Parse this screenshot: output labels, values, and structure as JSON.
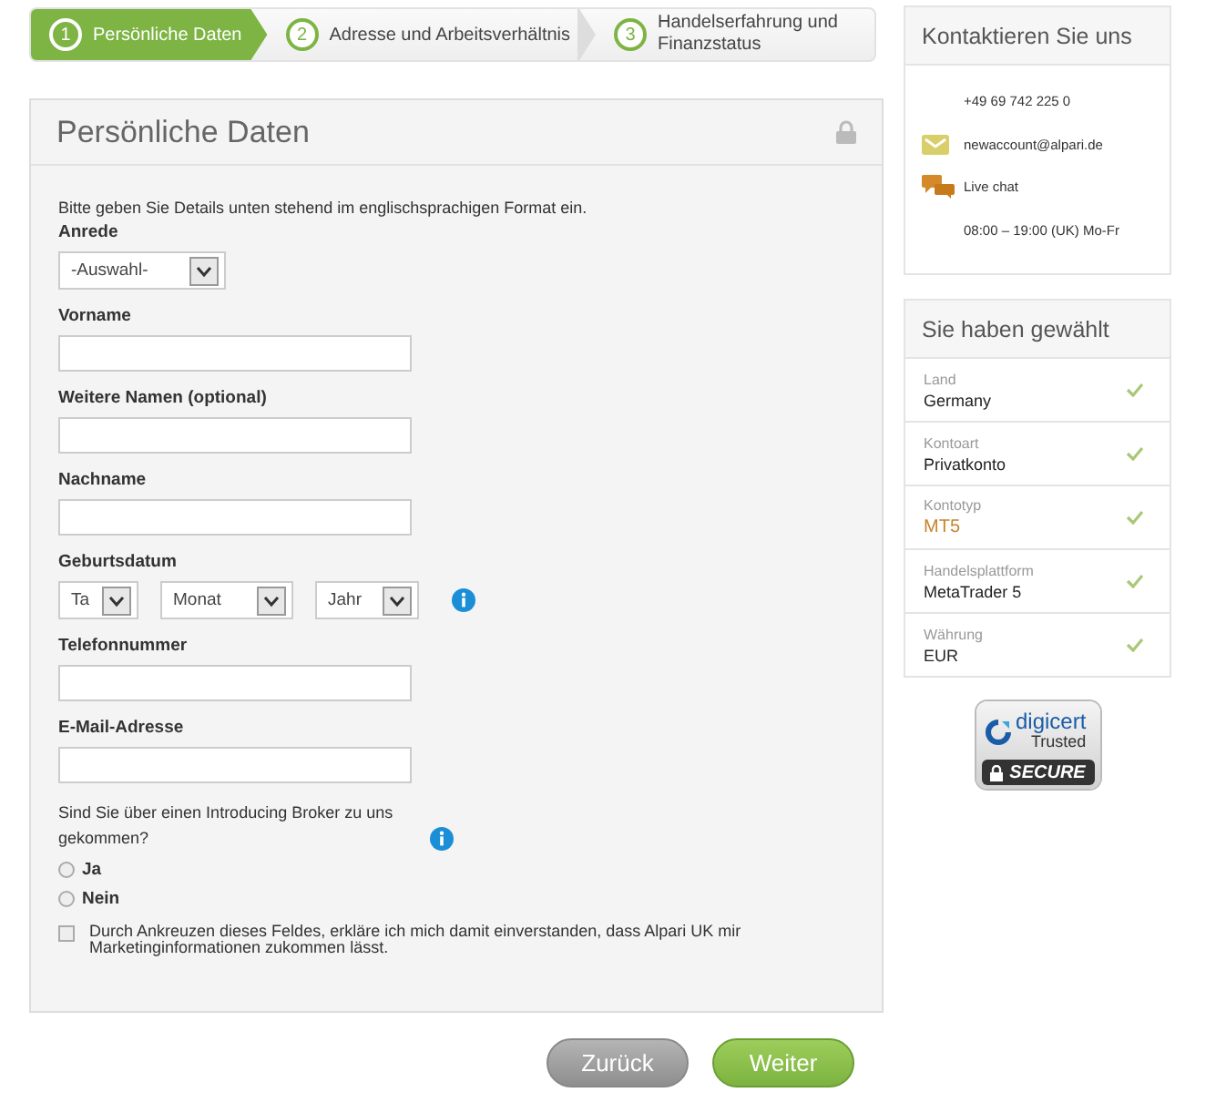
{
  "steps": [
    {
      "number": "1",
      "label": "Persönliche Daten",
      "selected": true
    },
    {
      "number": "2",
      "label": "Adresse und Arbeitsverhältnis",
      "selected": false
    },
    {
      "number": "3",
      "label": "Handelserfahrung und Finanzstatus",
      "selected": false
    }
  ],
  "form": {
    "title": "Persönliche Daten",
    "intro": "Bitte geben Sie Details unten stehend im englischsprachigen Format ein.",
    "fields": [
      {
        "kind": "select",
        "label": "Anrede",
        "value": "-Auswahl-"
      },
      {
        "kind": "text",
        "label": "Vorname"
      },
      {
        "kind": "text",
        "label": "Weitere Namen (optional)"
      },
      {
        "kind": "text",
        "label": "Nachname"
      },
      {
        "kind": "date",
        "label": "Geburtsdatum",
        "parts": [
          "Ta",
          "Monat",
          "Jahr"
        ],
        "info": true
      },
      {
        "kind": "text",
        "label": "Telefonnummer"
      },
      {
        "kind": "text",
        "label": "E-Mail-Adresse"
      },
      {
        "kind": "radio",
        "label": "Sind Sie über einen Introducing Broker zu uns gekommen?",
        "info": true,
        "options": [
          {
            "label": "Ja",
            "selected": false
          },
          {
            "label": "Nein",
            "selected": false
          }
        ]
      },
      {
        "kind": "checkbox",
        "label": "Durch Ankreuzen dieses Feldes, erkläre ich mich damit einverstanden, dass Alpari UK mir Marketinginformationen zukommen lässt.",
        "checked": false
      }
    ]
  },
  "buttons": [
    {
      "kind": "back",
      "label": "Zurück"
    },
    {
      "kind": "next",
      "label": "Weiter"
    }
  ],
  "contact": {
    "title": "Kontaktieren Sie uns",
    "items": [
      {
        "kind": "phone",
        "text": "+49 69 742 225 0"
      },
      {
        "kind": "email",
        "text": "newaccount@alpari.de"
      },
      {
        "kind": "chat",
        "text": "Live chat"
      },
      {
        "kind": "hours",
        "text": "08:00 – 19:00 (UK) Mo-Fr"
      }
    ]
  },
  "summary": {
    "title": "Sie haben gewählt",
    "items": [
      {
        "label": "Land",
        "value": "Germany",
        "checked": true,
        "highlight": false
      },
      {
        "label": "Kontoart",
        "value": "Privatkonto",
        "checked": true,
        "highlight": false
      },
      {
        "label": "Kontotyp",
        "value": "MT5",
        "checked": true,
        "highlight": true
      },
      {
        "label": "Handelsplattform",
        "value": "MetaTrader 5",
        "checked": true,
        "highlight": false
      },
      {
        "label": "Währung",
        "value": "EUR",
        "checked": true,
        "highlight": false
      }
    ]
  },
  "badge": {
    "brand": "digicert",
    "line": "Trusted",
    "seal": "SECURE"
  }
}
